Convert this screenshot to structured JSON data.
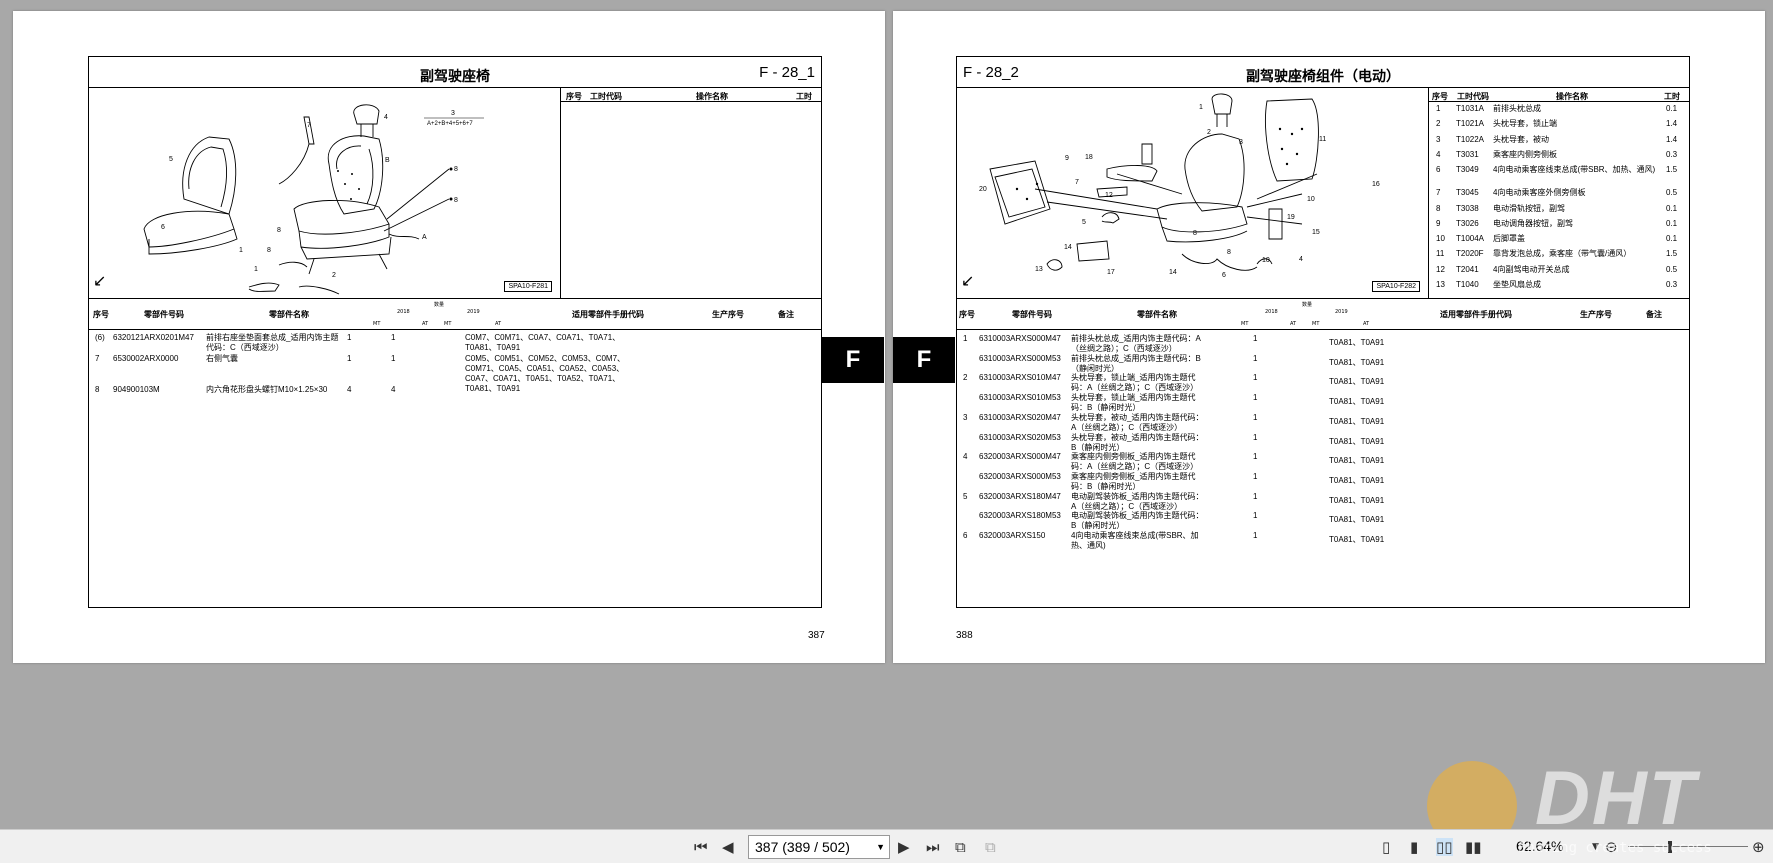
{
  "left_page": {
    "title": "副驾驶座椅",
    "code": "F - 28_1",
    "diagram_ref": "SPA10-F281",
    "formula_label": "3",
    "formula": "A+2+B+4+5+6+7",
    "labor_headers": {
      "no": "序号",
      "code": "工时代码",
      "op": "操作名称",
      "hours": "工时"
    },
    "parts_headers": {
      "no": "序号",
      "part_no": "零部件号码",
      "name": "零部件名称",
      "qty": "数量",
      "y1": "2018",
      "y2": "2019",
      "mt": "MT",
      "at": "AT",
      "applicable": "适用零部件手册代码",
      "seq": "生产序号",
      "remark": "备注"
    },
    "parts": [
      {
        "no": "(6)",
        "part_no": "6320121ARX0201M47",
        "name": "前排右座坐垫面套总成_适用内饰主题代码：C（西域逐沙）",
        "q1": "1",
        "q2": "1",
        "applicable": "C0M7、C0M71、C0A7、C0A71、T0A71、T0A81、T0A91"
      },
      {
        "no": "7",
        "part_no": "6530002ARX0000",
        "name": "右侧气囊",
        "q1": "1",
        "q2": "1",
        "applicable": "C0M5、C0M51、C0M52、C0M53、C0M7、C0M71、C0A5、C0A51、C0A52、C0A53、C0A7、C0A71、T0A51、T0A52、T0A71、T0A81、T0A91"
      },
      {
        "no": "8",
        "part_no": "904900103M",
        "name": "内六角花形盘头螺钉M10×1.25×30",
        "q1": "4",
        "q2": "4",
        "applicable": ""
      }
    ],
    "page_number": "387",
    "tab": "F"
  },
  "right_page": {
    "title": "副驾驶座椅组件（电动）",
    "code": "F - 28_2",
    "diagram_ref": "SPA10-F282",
    "labor_headers": {
      "no": "序号",
      "code": "工时代码",
      "op": "操作名称",
      "hours": "工时"
    },
    "labor": [
      {
        "no": "1",
        "code": "T1031A",
        "op": "前排头枕总成",
        "hours": "0.1"
      },
      {
        "no": "2",
        "code": "T1021A",
        "op": "头枕导套，锁止端",
        "hours": "1.4"
      },
      {
        "no": "3",
        "code": "T1022A",
        "op": "头枕导套，被动",
        "hours": "1.4"
      },
      {
        "no": "4",
        "code": "T3031",
        "op": "乘客座内侧旁侧板",
        "hours": "0.3"
      },
      {
        "no": "6",
        "code": "T3049",
        "op": "4向电动乘客座线束总成(带SBR、加热、通风)",
        "hours": "1.5"
      },
      {
        "no": "7",
        "code": "T3045",
        "op": "4向电动乘客座外侧旁侧板",
        "hours": "0.5"
      },
      {
        "no": "8",
        "code": "T3038",
        "op": "电动滑轨按钮，副驾",
        "hours": "0.1"
      },
      {
        "no": "9",
        "code": "T3026",
        "op": "电动调角器按钮，副驾",
        "hours": "0.1"
      },
      {
        "no": "10",
        "code": "T1004A",
        "op": "后脚罩盖",
        "hours": "0.1"
      },
      {
        "no": "11",
        "code": "T2020F",
        "op": "靠背发泡总成，乘客座（带气囊/通风）",
        "hours": "1.5"
      },
      {
        "no": "12",
        "code": "T2041",
        "op": "4向副驾电动开关总成",
        "hours": "0.5"
      },
      {
        "no": "13",
        "code": "T1040",
        "op": "坐垫风扇总成",
        "hours": "0.3"
      }
    ],
    "parts_headers": {
      "no": "序号",
      "part_no": "零部件号码",
      "name": "零部件名称",
      "qty": "数量",
      "y1": "2018",
      "y2": "2019",
      "mt": "MT",
      "at": "AT",
      "applicable": "适用零部件手册代码",
      "seq": "生产序号",
      "remark": "备注"
    },
    "parts": [
      {
        "no": "1",
        "part_no": "6310003ARXS000M47",
        "name": "前排头枕总成_适用内饰主题代码：A（丝绸之路）；C（西域逐沙）",
        "q": "1",
        "applicable": "T0A81、T0A91"
      },
      {
        "no": "",
        "part_no": "6310003ARXS000M53",
        "name": "前排头枕总成_适用内饰主题代码：B（静闲时光）",
        "q": "1",
        "applicable": "T0A81、T0A91"
      },
      {
        "no": "2",
        "part_no": "6310003ARXS010M47",
        "name": "头枕导套，锁止端_适用内饰主题代码：A（丝绸之路）；C（西域逐沙）",
        "q": "1",
        "applicable": "T0A81、T0A91"
      },
      {
        "no": "",
        "part_no": "6310003ARXS010M53",
        "name": "头枕导套，锁止端_适用内饰主题代码：B（静闲时光）",
        "q": "1",
        "applicable": "T0A81、T0A91"
      },
      {
        "no": "3",
        "part_no": "6310003ARXS020M47",
        "name": "头枕导套，被动_适用内饰主题代码：A（丝绸之路）；C（西域逐沙）",
        "q": "1",
        "applicable": "T0A81、T0A91"
      },
      {
        "no": "",
        "part_no": "6310003ARXS020M53",
        "name": "头枕导套，被动_适用内饰主题代码：B（静闲时光）",
        "q": "1",
        "applicable": "T0A81、T0A91"
      },
      {
        "no": "4",
        "part_no": "6320003ARXS000M47",
        "name": "乘客座内侧旁侧板_适用内饰主题代码：A（丝绸之路）；C（西域逐沙）",
        "q": "1",
        "applicable": "T0A81、T0A91"
      },
      {
        "no": "",
        "part_no": "6320003ARXS000M53",
        "name": "乘客座内侧旁侧板_适用内饰主题代码：B（静闲时光）",
        "q": "1",
        "applicable": "T0A81、T0A91"
      },
      {
        "no": "5",
        "part_no": "6320003ARXS180M47",
        "name": "电动副驾装饰板_适用内饰主题代码：A（丝绸之路）；C（西域逐沙）",
        "q": "1",
        "applicable": "T0A81、T0A91"
      },
      {
        "no": "",
        "part_no": "6320003ARXS180M53",
        "name": "电动副驾装饰板_适用内饰主题代码：B（静闲时光）",
        "q": "1",
        "applicable": "T0A81、T0A91"
      },
      {
        "no": "6",
        "part_no": "6320003ARXS150",
        "name": "4向电动乘客座线束总成(带SBR、加热、通风)",
        "q": "1",
        "applicable": "T0A81、T0A91"
      }
    ],
    "page_number": "388",
    "tab": "F"
  },
  "toolbar": {
    "page_value": "387 (389 / 502)",
    "zoom": "62.64%",
    "watermark": "DHT",
    "watermark_sub": "Sharing creates success"
  }
}
